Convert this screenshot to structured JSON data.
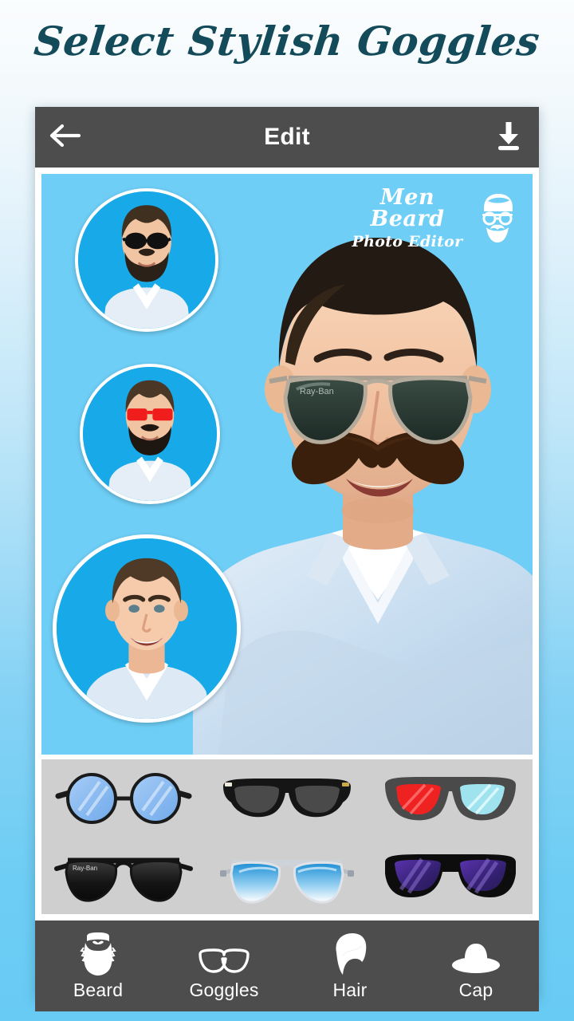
{
  "promo": {
    "title": "Select Stylish Goggles",
    "title_color": "#134b5a"
  },
  "background": {
    "top_color": "#fbfdfe",
    "bottom_color": "#68cbf4"
  },
  "toolbar": {
    "back_icon": "arrow-left-icon",
    "title": "Edit",
    "save_icon": "download-icon",
    "background_color": "#4d4d4d",
    "text_color": "#ffffff"
  },
  "canvas": {
    "background_color": "#6ecef6",
    "watermark": {
      "line1": "Men Beard",
      "line2": "Photo Editor",
      "mark_icon": "bearded-man-icon",
      "color": "#ffffff"
    },
    "subject": {
      "description": "man wearing dark green aviator sunglasses and handlebar mustache",
      "glasses_color": "#2b3b35",
      "mustache_color": "#3a1f0c",
      "skin_color": "#f3c6a6",
      "hair_color": "#241a14",
      "shirt_color": "#cfe0ef"
    },
    "thumbnails": [
      {
        "id": "thumb-bearded-black-aviator",
        "description": "bearded man with black aviator sunglasses",
        "glasses_color": "#111111",
        "beard_color": "#2b2119",
        "selected": false
      },
      {
        "id": "thumb-bearded-red-goggles",
        "description": "bearded man with red rectangular sunglasses",
        "glasses_color": "#f01d1d",
        "beard_color": "#1d1611",
        "selected": false
      },
      {
        "id": "thumb-clean-shaven-smiling",
        "description": "young clean shaven smiling man",
        "glasses_color": "none",
        "beard_color": "none",
        "selected": true
      }
    ]
  },
  "tray": {
    "background_color": "#cfcfcf",
    "items": [
      {
        "id": "goggles-round-blue",
        "name": "round blue lens glasses",
        "frame_color": "#1a1a1a",
        "lens_color": "#7ab4f0",
        "style": "round"
      },
      {
        "id": "goggles-black-wayfarer",
        "name": "black wayfarer sunglasses",
        "frame_color": "#151515",
        "lens_color": "#4a4a4a",
        "style": "wayfarer"
      },
      {
        "id": "goggles-3d-red-cyan",
        "name": "3D red and cyan glasses",
        "frame_color": "#4a4a4a",
        "lens_color": "#ef2222",
        "lens_color_2": "#9fe3ee",
        "style": "3d"
      },
      {
        "id": "goggles-black-aviator",
        "name": "black aviator sunglasses",
        "frame_color": "#141414",
        "lens_color": "#1b1b1b",
        "style": "aviator"
      },
      {
        "id": "goggles-blue-aviator",
        "name": "blue gradient aviators",
        "frame_color": "#c9ccd1",
        "lens_color": "#1e8fd4",
        "style": "aviator"
      },
      {
        "id": "goggles-purple-wayfarer",
        "name": "purple lens wayfarer",
        "frame_color": "#0d0d0d",
        "lens_color": "#4a2d96",
        "style": "wayfarer"
      }
    ]
  },
  "bottom_nav": {
    "background_color": "#4d4d4d",
    "items": [
      {
        "id": "nav-beard",
        "label": "Beard",
        "icon": "beard-icon",
        "active": false
      },
      {
        "id": "nav-goggles",
        "label": "Goggles",
        "icon": "goggles-icon",
        "active": true
      },
      {
        "id": "nav-hair",
        "label": "Hair",
        "icon": "hair-icon",
        "active": false
      },
      {
        "id": "nav-cap",
        "label": "Cap",
        "icon": "cap-icon",
        "active": false
      }
    ]
  }
}
